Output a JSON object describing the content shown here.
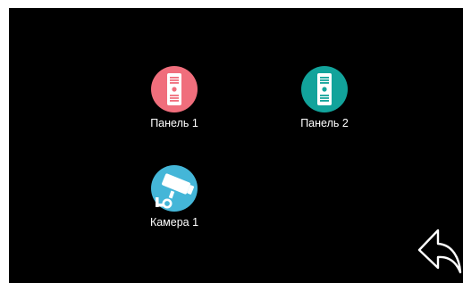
{
  "devices": [
    {
      "label": "Панель 1",
      "icon": "door-panel-icon",
      "color": "#f06e7c"
    },
    {
      "label": "Панель 2",
      "icon": "door-panel-icon",
      "color": "#12a39b"
    },
    {
      "label": "Камера 1",
      "icon": "cctv-camera-icon",
      "color": "#44b6d8"
    }
  ],
  "back": {
    "icon": "back-arrow-icon"
  },
  "colors": {
    "screen_background": "#000000",
    "label_text": "#ffffff"
  }
}
